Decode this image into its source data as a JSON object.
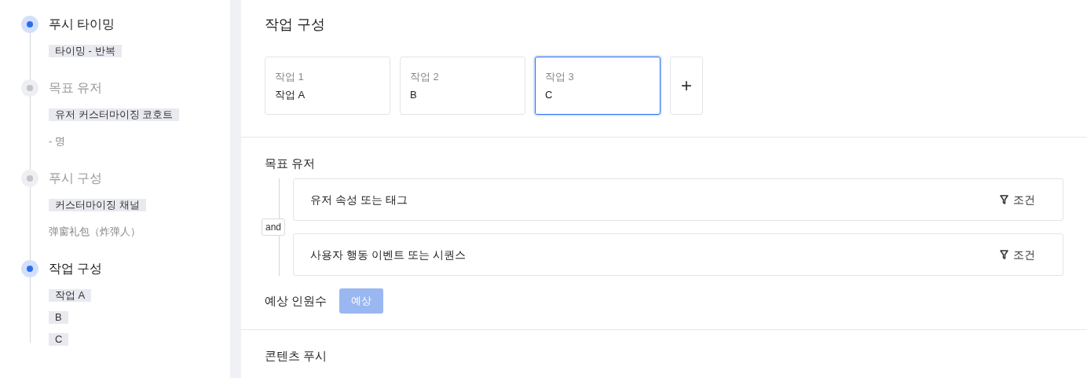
{
  "steps": [
    {
      "title": "푸시 타이밍",
      "active": true,
      "items": [
        {
          "kind": "tag",
          "text": "타이밍 - 반복"
        }
      ]
    },
    {
      "title": "목표 유저",
      "active": false,
      "items": [
        {
          "kind": "tag",
          "text": "유저 커스터마이징 코호트"
        },
        {
          "kind": "text",
          "text": "- 명"
        }
      ]
    },
    {
      "title": "푸시 구성",
      "active": false,
      "items": [
        {
          "kind": "tag",
          "text": "커스터마이징 채널"
        },
        {
          "kind": "text",
          "text": "弹窗礼包（炸弹人）"
        }
      ]
    },
    {
      "title": "작업 구성",
      "active": true,
      "items": [
        {
          "kind": "tag",
          "text": "작업 A"
        },
        {
          "kind": "tag",
          "text": "B"
        },
        {
          "kind": "tag",
          "text": "C"
        }
      ]
    }
  ],
  "task_section": {
    "title": "작업 구성",
    "tasks": [
      {
        "label": "작업 1",
        "value": "작업 A",
        "selected": false
      },
      {
        "label": "작업 2",
        "value": "B",
        "selected": false
      },
      {
        "label": "작업 3",
        "value": "C",
        "selected": true
      }
    ],
    "add_label": "+"
  },
  "target_section": {
    "title": "목표 유저",
    "operator": "and",
    "conditions": [
      {
        "label": "유저 속성 또는 태그",
        "action": "조건"
      },
      {
        "label": "사용자 행동 이벤트 또는 시퀀스",
        "action": "조건"
      }
    ],
    "estimate_label": "예상 인원수",
    "estimate_button": {
      "label": "예상",
      "disabled": true
    }
  },
  "content_section": {
    "title": "콘텐츠 푸시"
  }
}
